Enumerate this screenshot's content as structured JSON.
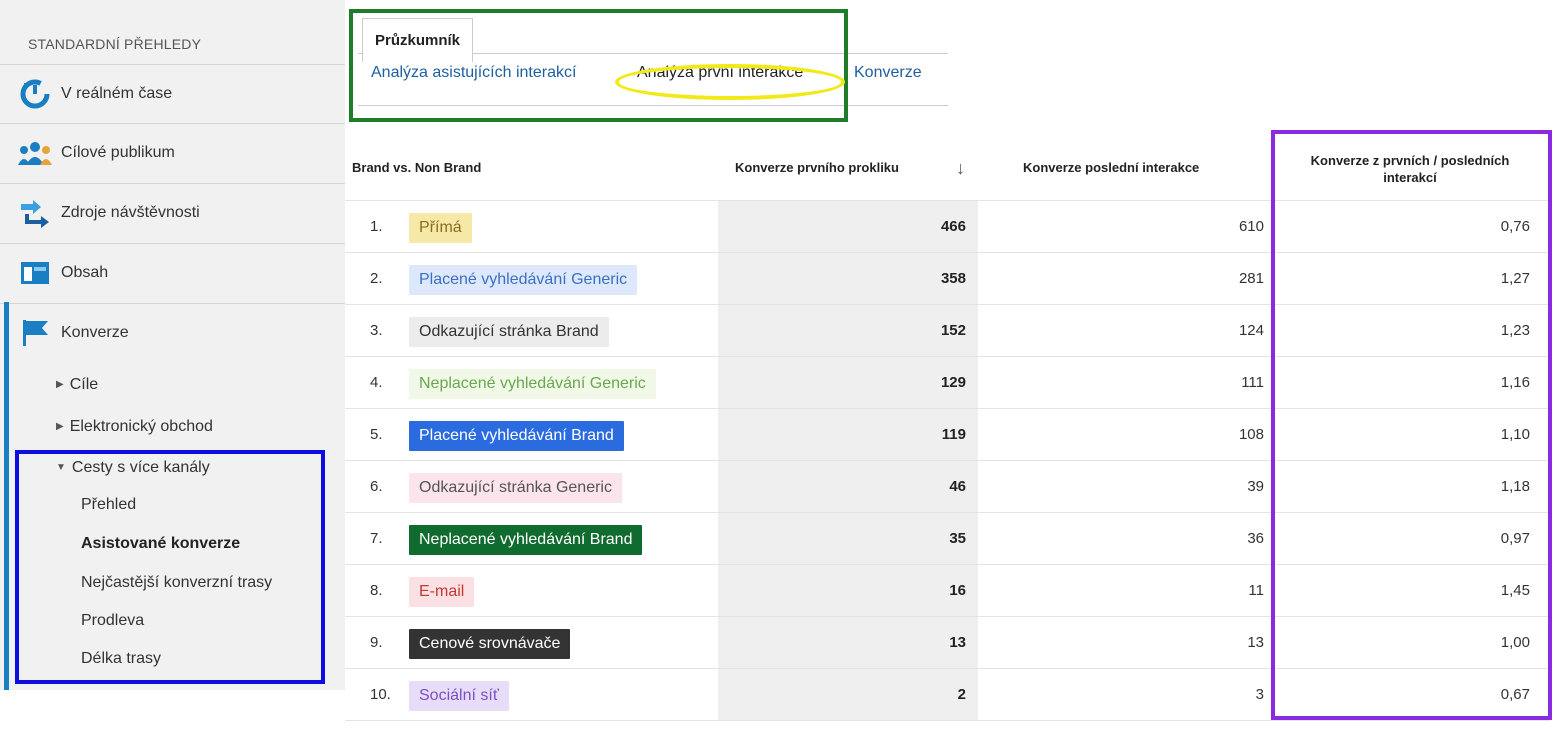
{
  "sidebar": {
    "title": "STANDARDNÍ PŘEHLEDY",
    "items": [
      {
        "label": "V reálném čase",
        "icon": "realtime-icon"
      },
      {
        "label": "Cílové publikum",
        "icon": "audience-icon"
      },
      {
        "label": "Zdroje návštěvnosti",
        "icon": "acquisition-icon"
      },
      {
        "label": "Obsah",
        "icon": "content-icon"
      },
      {
        "label": "Konverze",
        "icon": "flag-icon"
      }
    ],
    "sub": {
      "goals": "Cíle",
      "ecommerce": "Elektronický obchod",
      "mcf": "Cesty s více kanály"
    },
    "leaves": {
      "overview": "Přehled",
      "assisted": "Asistované konverze",
      "top_paths": "Nejčastější konverzní trasy",
      "time_lag": "Prodleva",
      "path_length": "Délka trasy"
    }
  },
  "explorer": {
    "tab": "Průzkumník",
    "links": {
      "assisted": "Analýza asistujících interakcí",
      "first": "Analýza první interakce",
      "conversions": "Konverze"
    }
  },
  "table": {
    "headers": {
      "dimension": "Brand vs. Non Brand",
      "first_click": "Konverze prvního prokliku",
      "last_interaction": "Konverze poslední interakce",
      "ratio": "Konverze z prvních / posledních interakcí"
    },
    "rows": [
      {
        "n": "1.",
        "label": "Přímá",
        "first": "466",
        "last": "610",
        "ratio": "0,76",
        "bg": "#f6e8a6",
        "fg": "#8a6d1e"
      },
      {
        "n": "2.",
        "label": "Placené vyhledávání Generic",
        "first": "358",
        "last": "281",
        "ratio": "1,27",
        "bg": "#dde9fb",
        "fg": "#3b6fc4"
      },
      {
        "n": "3.",
        "label": "Odkazující stránka Brand",
        "first": "152",
        "last": "124",
        "ratio": "1,23",
        "bg": "#ececec",
        "fg": "#333333"
      },
      {
        "n": "4.",
        "label": "Neplacené vyhledávání Generic",
        "first": "129",
        "last": "111",
        "ratio": "1,16",
        "bg": "#f1f8e8",
        "fg": "#6aa84f"
      },
      {
        "n": "5.",
        "label": "Placené vyhledávání Brand",
        "first": "119",
        "last": "108",
        "ratio": "1,10",
        "bg": "#2a6be0",
        "fg": "#ffffff"
      },
      {
        "n": "6.",
        "label": "Odkazující stránka Generic",
        "first": "46",
        "last": "39",
        "ratio": "1,18",
        "bg": "#fbe4ec",
        "fg": "#555555"
      },
      {
        "n": "7.",
        "label": "Neplacené vyhledávání Brand",
        "first": "35",
        "last": "36",
        "ratio": "0,97",
        "bg": "#0f6b2e",
        "fg": "#ffffff"
      },
      {
        "n": "8.",
        "label": "E-mail",
        "first": "16",
        "last": "11",
        "ratio": "1,45",
        "bg": "#fbe1e3",
        "fg": "#c0392b"
      },
      {
        "n": "9.",
        "label": "Cenové srovnávače",
        "first": "13",
        "last": "13",
        "ratio": "1,00",
        "bg": "#333333",
        "fg": "#ffffff"
      },
      {
        "n": "10.",
        "label": "Sociální síť",
        "first": "2",
        "last": "3",
        "ratio": "0,67",
        "bg": "#e7ddf8",
        "fg": "#7b4fc4"
      }
    ]
  },
  "colors": {
    "highlight_green": "#1f7d2a",
    "highlight_yellow": "#f2ea18",
    "highlight_blue": "#0d0de0",
    "highlight_purple": "#8a2be2",
    "link": "#1f5fa0"
  }
}
